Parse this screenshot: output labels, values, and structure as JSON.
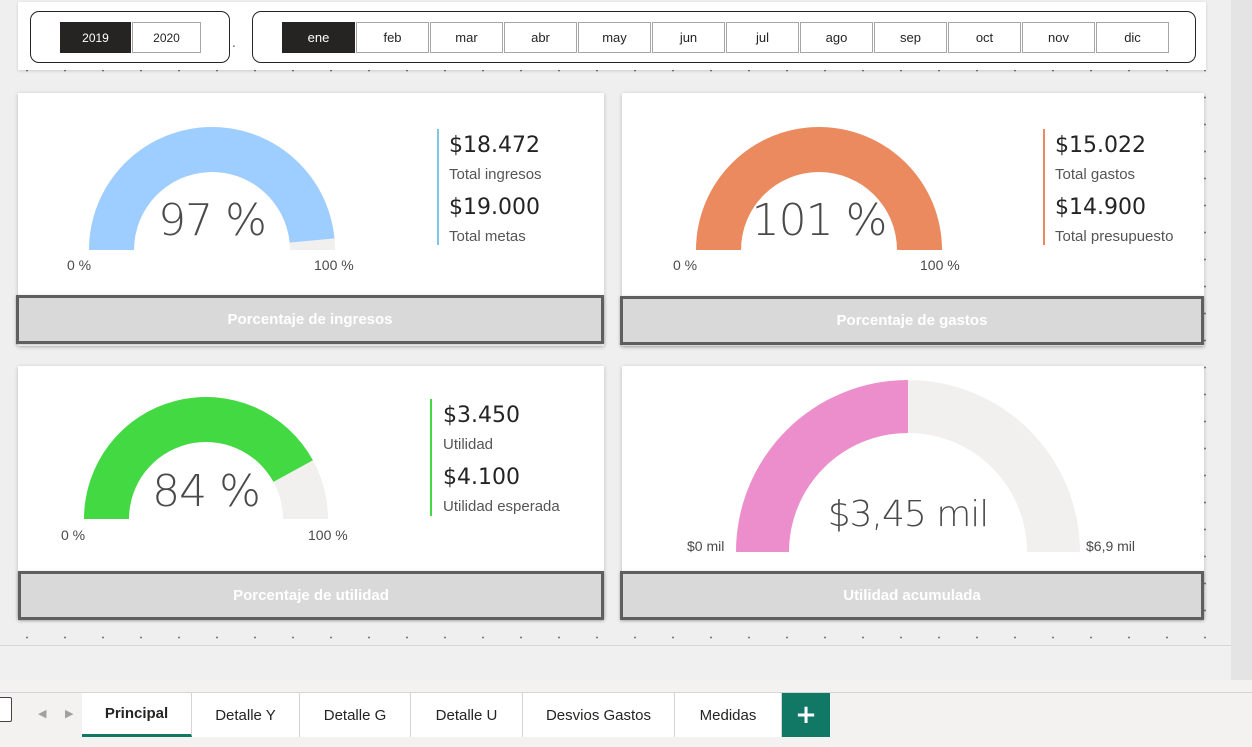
{
  "years": {
    "items": [
      "2019",
      "2020"
    ],
    "selected": "2019"
  },
  "months": {
    "items": [
      "ene",
      "feb",
      "mar",
      "abr",
      "may",
      "jun",
      "jul",
      "ago",
      "sep",
      "oct",
      "nov",
      "dic"
    ],
    "selected": "ene"
  },
  "ingresos": {
    "percent": 97,
    "percent_text": "97 %",
    "axis_min": "0 %",
    "axis_max": "100 %",
    "color": "#9ecdff",
    "kpi1_value": "$18.472",
    "kpi1_label": "Total ingresos",
    "kpi2_value": "$19.000",
    "kpi2_label": "Total metas",
    "bar_color": "#7ec7e8",
    "title": "Porcentaje de ingresos"
  },
  "gastos": {
    "percent": 101,
    "percent_text": "101 %",
    "axis_min": "0 %",
    "axis_max": "100 %",
    "color": "#ea8a5e",
    "kpi1_value": "$15.022",
    "kpi1_label": "Total gastos",
    "kpi2_value": "$14.900",
    "kpi2_label": "Total presupuesto",
    "bar_color": "#ea8a5e",
    "title": "Porcentaje de gastos"
  },
  "utilidad": {
    "percent": 84,
    "percent_text": "84 %",
    "axis_min": "0 %",
    "axis_max": "100 %",
    "color": "#43d943",
    "kpi1_value": "$3.450",
    "kpi1_label": "Utilidad",
    "kpi2_value": "$4.100",
    "kpi2_label": "Utilidad esperada",
    "bar_color": "#43d943",
    "title": "Porcentaje de utilidad"
  },
  "acumulada": {
    "value": 3.45,
    "max": 6.9,
    "value_text": "$3,45 mil",
    "axis_min": "$0 mil",
    "axis_max": "$6,9 mil",
    "color": "#ec8ecb",
    "title": "Utilidad acumulada"
  },
  "gauge_track_color": "#f1f0ef",
  "tabs": [
    "Principal",
    "Detalle Y",
    "Detalle G",
    "Detalle U",
    "Desvios Gastos",
    "Medidas"
  ],
  "active_tab": "Principal",
  "add_tab_label": "+"
}
